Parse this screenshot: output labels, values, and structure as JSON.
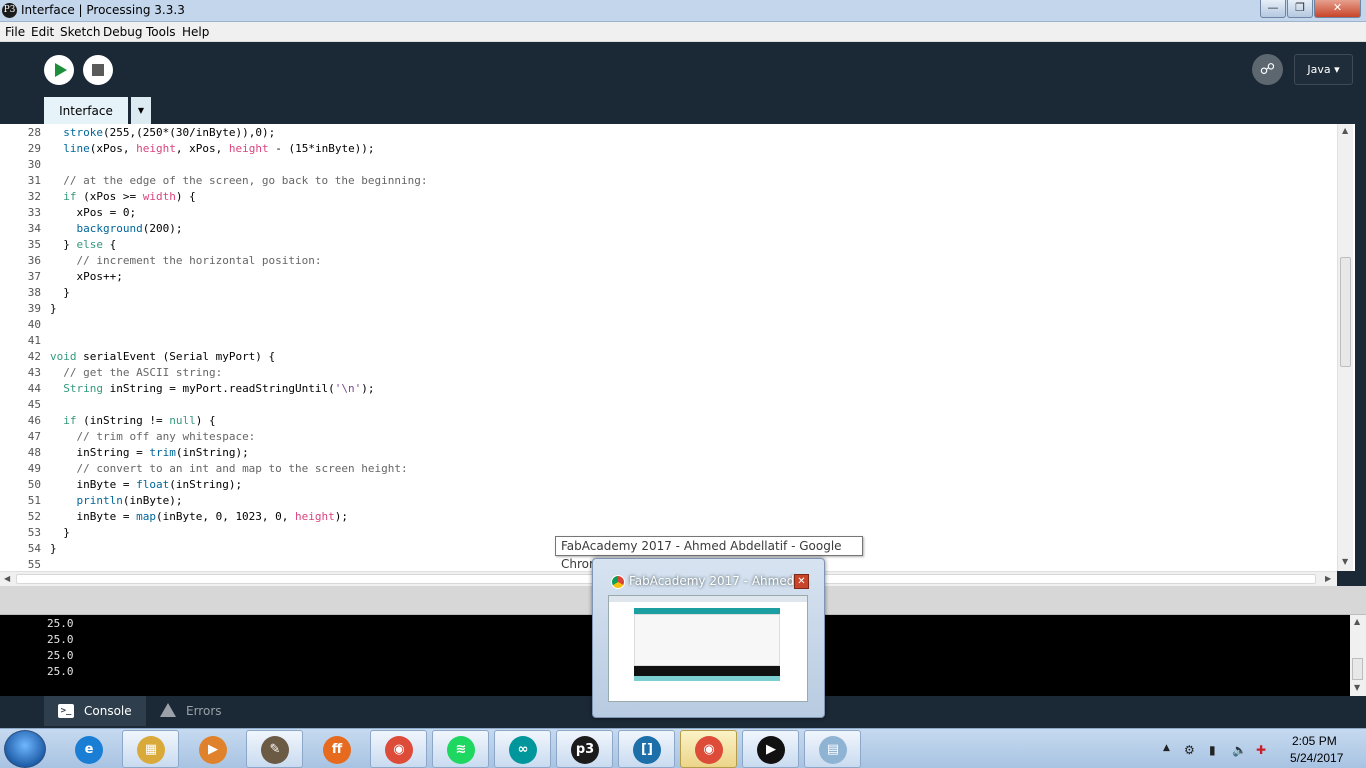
{
  "window": {
    "title": "Interface | Processing 3.3.3",
    "icon_glyph": "P3",
    "min": "—",
    "max": "❐",
    "close": "✕"
  },
  "menu": [
    "File",
    "Edit",
    "Sketch",
    "Debug",
    "Tools",
    "Help"
  ],
  "toolbar": {
    "mode_label": "Java ▾",
    "debug_glyph": "☍"
  },
  "tabs": {
    "active": "Interface",
    "menu_glyph": "▼"
  },
  "code_lines": [
    {
      "n": "28",
      "html": "  <span class=\"fn\">stroke</span>(255,(250*(30/inByte)),0);"
    },
    {
      "n": "29",
      "html": "  <span class=\"fn\">line</span>(xPos, <span class=\"var\">height</span>, xPos, <span class=\"var\">height</span> - (15*inByte));"
    },
    {
      "n": "30",
      "html": ""
    },
    {
      "n": "31",
      "html": "  <span class=\"cm\">// at the edge of the screen, go back to the beginning:</span>"
    },
    {
      "n": "32",
      "html": "  <span class=\"kw\">if</span> (xPos &gt;= <span class=\"var\">width</span>) {"
    },
    {
      "n": "33",
      "html": "    xPos = 0;"
    },
    {
      "n": "34",
      "html": "    <span class=\"fn\">background</span>(200);"
    },
    {
      "n": "35",
      "html": "  } <span class=\"kw\">else</span> {"
    },
    {
      "n": "36",
      "html": "    <span class=\"cm\">// increment the horizontal position:</span>"
    },
    {
      "n": "37",
      "html": "    xPos++;"
    },
    {
      "n": "38",
      "html": "  }"
    },
    {
      "n": "39",
      "html": "}"
    },
    {
      "n": "40",
      "html": ""
    },
    {
      "n": "41",
      "html": ""
    },
    {
      "n": "42",
      "html": "<span class=\"kw\">void</span> serialEvent (Serial myPort) {"
    },
    {
      "n": "43",
      "html": "  <span class=\"cm\">// get the ASCII string:</span>"
    },
    {
      "n": "44",
      "html": "  <span class=\"kw\">String</span> inString = myPort.readStringUntil(<span class=\"str\">'\\n'</span>);"
    },
    {
      "n": "45",
      "html": ""
    },
    {
      "n": "46",
      "html": "  <span class=\"kw\">if</span> (inString != <span class=\"kw\">null</span>) {"
    },
    {
      "n": "47",
      "html": "    <span class=\"cm\">// trim off any whitespace:</span>"
    },
    {
      "n": "48",
      "html": "    inString = <span class=\"fn\">trim</span>(inString);"
    },
    {
      "n": "49",
      "html": "    <span class=\"cm\">// convert to an int and map to the screen height:</span>"
    },
    {
      "n": "50",
      "html": "    inByte = <span class=\"fn\">float</span>(inString);"
    },
    {
      "n": "51",
      "html": "    <span class=\"fn\">println</span>(inByte);"
    },
    {
      "n": "52",
      "html": "    inByte = <span class=\"fn\">map</span>(inByte, 0, 1023, 0, <span class=\"var\">height</span>);"
    },
    {
      "n": "53",
      "html": "  }"
    },
    {
      "n": "54",
      "html": "}"
    },
    {
      "n": "55",
      "html": ""
    }
  ],
  "console_lines": [
    "25.0",
    "25.0",
    "25.0",
    "25.0"
  ],
  "footer": {
    "console_label": "Console",
    "errors_label": "Errors",
    "console_icon": ">_"
  },
  "taskbar": {
    "tooltip": "FabAcademy 2017 - Ahmed Abdellatif - Google Chrome",
    "preview_title": "FabAcademy 2017 - Ahmed ...",
    "preview_close": "✕",
    "apps": [
      {
        "name": "internet-explorer-icon",
        "glyph": "e",
        "color": "#1a7fd4",
        "state": "off"
      },
      {
        "name": "file-explorer-icon",
        "glyph": "▦",
        "color": "#d9a93a",
        "state": "on"
      },
      {
        "name": "media-player-icon",
        "glyph": "▶",
        "color": "#e0822c",
        "state": "off"
      },
      {
        "name": "gimp-icon",
        "glyph": "✎",
        "color": "#6b5a44",
        "state": "on"
      },
      {
        "name": "firefox-icon",
        "glyph": "ff",
        "color": "#e66b1f",
        "state": "off"
      },
      {
        "name": "chrome-icon",
        "glyph": "◉",
        "color": "#dd4b39",
        "state": "on"
      },
      {
        "name": "spotify-icon",
        "glyph": "≋",
        "color": "#1ed760",
        "state": "on"
      },
      {
        "name": "arduino-icon",
        "glyph": "∞",
        "color": "#00979c",
        "state": "on"
      },
      {
        "name": "processing-icon",
        "glyph": "p3",
        "color": "#1b1b1b",
        "state": "on"
      },
      {
        "name": "brackets-icon",
        "glyph": "[]",
        "color": "#1c6fa8",
        "state": "on"
      },
      {
        "name": "chrome-icon-2",
        "glyph": "◉",
        "color": "#dd4b39",
        "state": "sel"
      },
      {
        "name": "player-icon",
        "glyph": "▶",
        "color": "#111111",
        "state": "on"
      },
      {
        "name": "notepad-icon",
        "glyph": "▤",
        "color": "#8fb3d3",
        "state": "on"
      }
    ],
    "clock_time": "2:05 PM",
    "clock_date": "5/24/2017",
    "tray_glyphs": [
      "▲",
      "⚙",
      "▮",
      "🔈",
      "✚"
    ]
  }
}
